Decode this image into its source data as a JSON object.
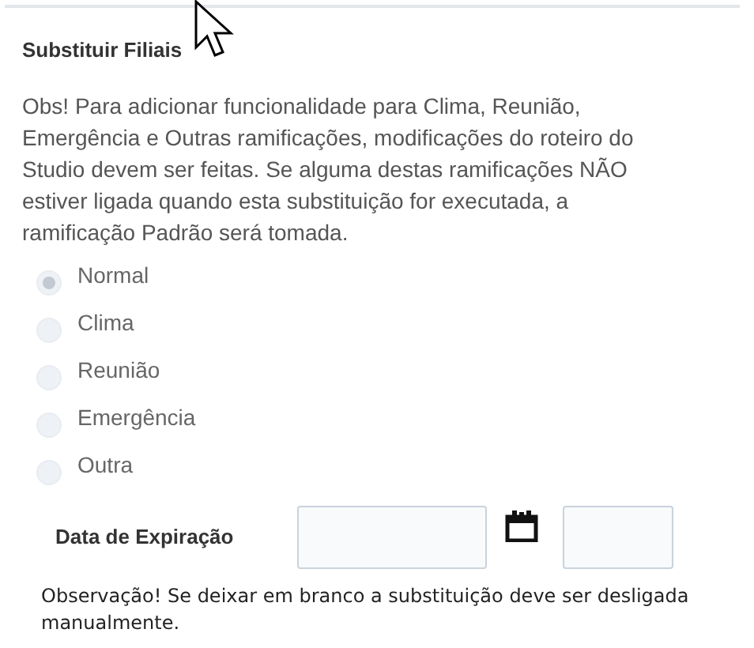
{
  "section": {
    "title": "Substituir Filiais",
    "note": "Obs! Para adicionar funcionalidade para Clima, Reunião, Emergência e Outras ramificações, modificações do roteiro do Studio devem ser feitas. Se alguma destas ramificações NÃO estiver ligada quando esta substituição for executada, a ramificação Padrão será tomada."
  },
  "branches": [
    {
      "label": "Normal",
      "selected": true,
      "disabled": true
    },
    {
      "label": "Clima",
      "selected": false,
      "disabled": true
    },
    {
      "label": "Reunião",
      "selected": false,
      "disabled": true
    },
    {
      "label": "Emergência",
      "selected": false,
      "disabled": true
    },
    {
      "label": "Outra",
      "selected": false,
      "disabled": true
    }
  ],
  "expiration": {
    "label": "Data de Expiração"
  },
  "footer_note": "Observação! Se deixar em branco a substituição deve ser desligada manualmente."
}
